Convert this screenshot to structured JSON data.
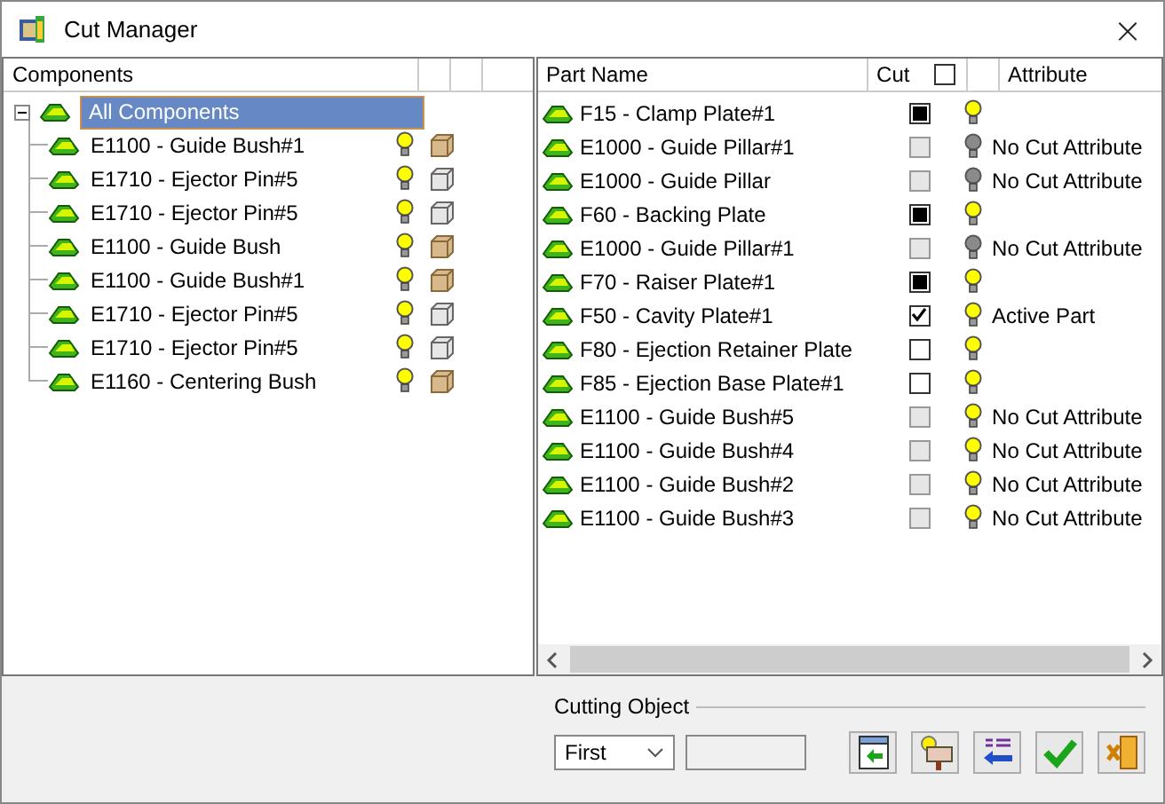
{
  "window": {
    "title": "Cut Manager",
    "close": "×"
  },
  "components": {
    "columns": [
      "Components"
    ],
    "tree": [
      {
        "label": "All Components",
        "selected": true,
        "expanded": true,
        "children": [
          {
            "label": "E1100 - Guide Bush#1",
            "light": true,
            "kind": "wood"
          },
          {
            "label": "E1710 - Ejector Pin#5",
            "light": true,
            "kind": "steel"
          },
          {
            "label": "E1710 - Ejector Pin#5",
            "light": true,
            "kind": "steel"
          },
          {
            "label": "E1100 - Guide Bush",
            "light": true,
            "kind": "wood"
          },
          {
            "label": "E1100 - Guide Bush#1",
            "light": true,
            "kind": "wood"
          },
          {
            "label": "E1710 - Ejector Pin#5",
            "light": true,
            "kind": "steel"
          },
          {
            "label": "E1710 - Ejector Pin#5",
            "light": true,
            "kind": "steel"
          },
          {
            "label": "E1160 - Centering Bush",
            "light": true,
            "kind": "wood"
          }
        ]
      }
    ]
  },
  "parts": {
    "columns": [
      "Part Name",
      "Cut",
      "Attribute"
    ],
    "cut_all_checked": false,
    "rows": [
      {
        "name": "F15 - Clamp Plate#1",
        "checked": false,
        "partial": true,
        "disabled": false,
        "light": true
      },
      {
        "name": "E1000 - Guide Pillar#1",
        "checked": false,
        "partial": false,
        "disabled": true,
        "light": false,
        "attribute": "No Cut Attribute"
      },
      {
        "name": "E1000 - Guide Pillar",
        "checked": false,
        "partial": false,
        "disabled": true,
        "light": false,
        "attribute": "No Cut Attribute"
      },
      {
        "name": "F60 - Backing Plate",
        "checked": false,
        "partial": true,
        "disabled": false,
        "light": true
      },
      {
        "name": "E1000 - Guide Pillar#1",
        "checked": false,
        "partial": false,
        "disabled": true,
        "light": false,
        "attribute": "No Cut Attribute"
      },
      {
        "name": "F70 - Raiser Plate#1",
        "checked": false,
        "partial": true,
        "disabled": false,
        "light": true
      },
      {
        "name": "F50 - Cavity Plate#1",
        "checked": true,
        "partial": false,
        "disabled": false,
        "light": true,
        "attribute": "Active Part"
      },
      {
        "name": "F80 - Ejection Retainer Plate",
        "checked": false,
        "partial": false,
        "disabled": false,
        "light": true
      },
      {
        "name": "F85 - Ejection Base Plate#1",
        "checked": false,
        "partial": false,
        "disabled": false,
        "light": true
      },
      {
        "name": "E1100 - Guide Bush#5",
        "checked": false,
        "partial": false,
        "disabled": true,
        "light": true,
        "attribute": "No Cut Attribute"
      },
      {
        "name": "E1100 - Guide Bush#4",
        "checked": false,
        "partial": false,
        "disabled": true,
        "light": true,
        "attribute": "No Cut Attribute"
      },
      {
        "name": "E1100 - Guide Bush#2",
        "checked": false,
        "partial": false,
        "disabled": true,
        "light": true,
        "attribute": "No Cut Attribute"
      },
      {
        "name": "E1100 - Guide Bush#3",
        "checked": false,
        "partial": false,
        "disabled": true,
        "light": true,
        "attribute": "No Cut Attribute"
      }
    ]
  },
  "cutting_object": {
    "label": "Cutting Object",
    "dropdown": "First"
  },
  "buttons": [
    {
      "kind": "insert"
    },
    {
      "kind": "highlight"
    },
    {
      "kind": "transfer"
    },
    {
      "kind": "ok"
    },
    {
      "kind": "exit"
    }
  ]
}
